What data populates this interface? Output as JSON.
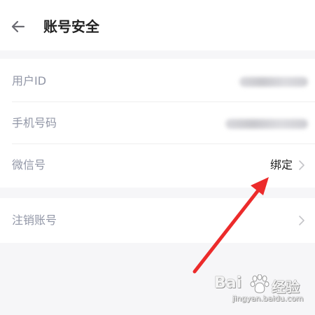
{
  "header": {
    "title": "账号安全"
  },
  "rows": [
    {
      "label": "用户ID"
    },
    {
      "label": "手机号码"
    },
    {
      "label": "微信号",
      "value": "绑定"
    },
    {
      "label": "注销账号"
    }
  ],
  "watermark": {
    "main": "Bai",
    "jingyan": "经验",
    "url": "jingyan.baidu.com"
  },
  "colors": {
    "annotation_arrow": "#ec2b2b",
    "label_text": "#9196a6",
    "value_text": "#222222"
  },
  "icons": [
    "back-arrow-icon",
    "chevron-right-icon",
    "baidu-paw-icon"
  ]
}
